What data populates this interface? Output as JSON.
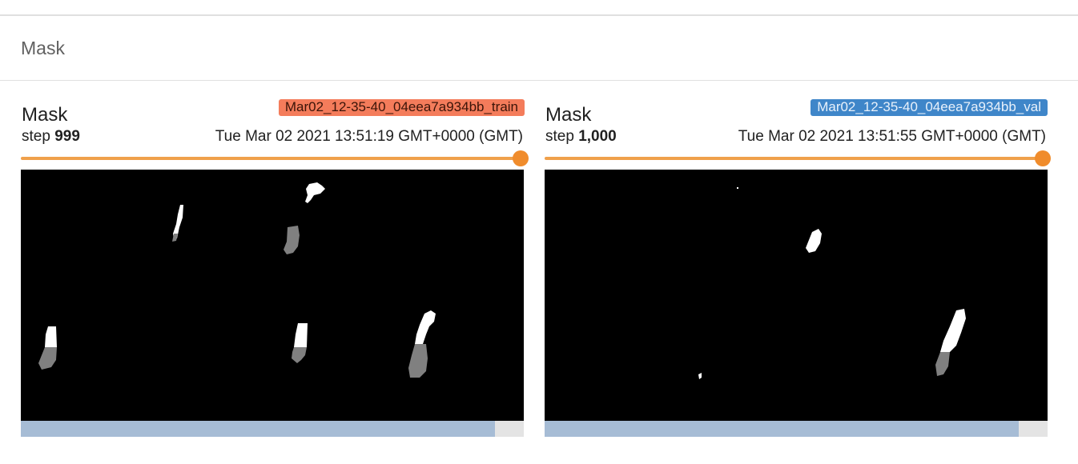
{
  "section": {
    "title": "Mask"
  },
  "cards": [
    {
      "title": "Mask",
      "run_tag": "Mar02_12-35-40_04eea7a934bb_train",
      "tag_color": "#f47c5b",
      "step_label": "step",
      "step_value": "999",
      "timestamp": "Tue Mar 02 2021 13:51:19 GMT+0000 (GMT)",
      "slider_position": 1.0,
      "scroll_fraction": 0.94,
      "image_description_icon": "mask-image"
    },
    {
      "title": "Mask",
      "run_tag": "Mar02_12-35-40_04eea7a934bb_val",
      "tag_color": "#3f86c9",
      "step_label": "step",
      "step_value": "1,000",
      "timestamp": "Tue Mar 02 2021 13:51:55 GMT+0000 (GMT)",
      "slider_position": 1.0,
      "scroll_fraction": 0.94,
      "image_description_icon": "mask-image"
    }
  ],
  "colors": {
    "slider": "#f0a04b",
    "scroll_thumb": "#a6bcd5",
    "mask_foreground": "#ffffff",
    "mask_secondary": "#808080",
    "background": "#000000"
  }
}
